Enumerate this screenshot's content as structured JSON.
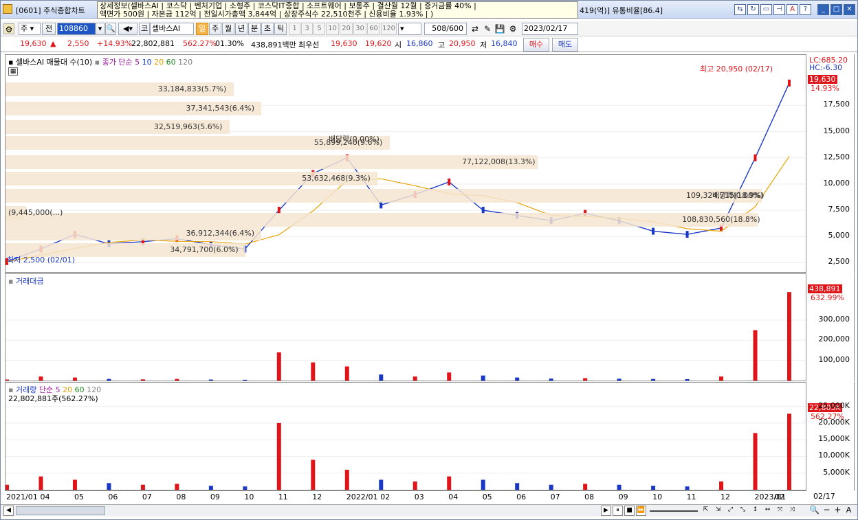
{
  "window": {
    "title": "[0601] 주식종합차트",
    "info_line1": "상세정보(셀바스AI | 코스닥 | 벤처기업 | 소형주 | 코스닥IT종합 | 소프트웨어 | 보통주 | 결산월 12월 | 증거금률 40% |",
    "info_line2": "액면가 500원 | 자본금 112억 | 전일시가총액 3,844억 | 상장주식수 22,510천주 | 신용비율 1.93% | )",
    "right_text": "419(억)] 유통비율[86.4]"
  },
  "toolbar": {
    "type_select": "주",
    "prev_label": "전",
    "code": "108860",
    "market_label": "코",
    "stock_name": "셀바스AI",
    "periods": [
      "일",
      "주",
      "월",
      "년",
      "분",
      "초",
      "틱"
    ],
    "active_period": "일",
    "intervals": [
      "1",
      "3",
      "5",
      "10",
      "20",
      "30",
      "60",
      "120"
    ],
    "count": "508",
    "count_total": "/600",
    "date": "2023/02/17"
  },
  "quote": {
    "price": "19,630",
    "arrow": "▲",
    "change": "2,550",
    "change_pct": "+14.93%",
    "volume": "22,802,881",
    "volume_ratio": "562.27%",
    "turnover": "01.30%",
    "amount": "438,891백만",
    "best_label": "최우선",
    "best_ask": "19,630",
    "best_bid": "19,620",
    "open_label": "시",
    "open": "16,860",
    "high_label": "고",
    "high": "20,950",
    "low_label": "저",
    "low": "16,840",
    "buy_label": "매수",
    "sell_label": "매도"
  },
  "price_pane": {
    "title": "셀바스AI 매물대 수(10)",
    "ma_label": "종가 단순",
    "ma_periods": [
      "5",
      "10",
      "20",
      "60",
      "120"
    ],
    "ma_colors": [
      "#1a38c8",
      "#1a38c8",
      "#e8a000",
      "#1f8a1f",
      "#808080"
    ],
    "lc_label": "LC:685.20",
    "hc_label": "HC:-6.30",
    "current_price": "19,630",
    "current_pct": "14.93%",
    "high_annot": "최고 20,950 (02/17)",
    "low_annot": "최저 2,500 (02/01)",
    "dividend_annots": [
      "배당락(0.00%)",
      "배당락(0.00%)"
    ],
    "y_ticks": [
      "17,500",
      "15,000",
      "12,500",
      "10,000",
      "7,500",
      "5,000",
      "2,500"
    ],
    "volume_profile": [
      {
        "label": "33,184,833(5.7%)",
        "frac": 0.057
      },
      {
        "label": "37,341,543(6.4%)",
        "frac": 0.064
      },
      {
        "label": "32,519,963(5.6%)",
        "frac": 0.056
      },
      {
        "label": "55,899,240(9.6%)",
        "frac": 0.096
      },
      {
        "label": "77,122,008(13.3%)",
        "frac": 0.133
      },
      {
        "label": "53,632,468(9.3%)",
        "frac": 0.093
      },
      {
        "label": "109,324,715(18.9%)",
        "frac": 0.189
      },
      {
        "label": "(9,445,000(...)",
        "frac": 0.0
      },
      {
        "label": "108,830,560(18.8%)",
        "frac": 0.188
      },
      {
        "label": "36,912,344(6.4%)",
        "frac": 0.064
      },
      {
        "label": "34,791,700(6.0%)",
        "frac": 0.06
      }
    ]
  },
  "amount_pane": {
    "title": "거래대금",
    "current": "438,891",
    "current_pct": "632.99%",
    "y_ticks": [
      "300,000",
      "200,000",
      "100,000"
    ]
  },
  "volume_pane": {
    "title": "거래량",
    "ma_label": "단순",
    "ma_periods": [
      "5",
      "20",
      "60",
      "120"
    ],
    "current_line": "22,802,881주(562.27%)",
    "current": "22,803K",
    "current_pct": "562.27%",
    "y_ticks": [
      "25,000K",
      "20,000K",
      "15,000K",
      "10,000K",
      "5,000K"
    ]
  },
  "x_axis": {
    "ticks": [
      "2021/01",
      "04",
      "05",
      "06",
      "07",
      "08",
      "09",
      "10",
      "11",
      "12",
      "2022/01",
      "02",
      "03",
      "04",
      "05",
      "06",
      "07",
      "08",
      "09",
      "10",
      "11",
      "12",
      "2023/01",
      "02"
    ],
    "right_label": "02/17"
  },
  "chart_data": {
    "type": "line",
    "title": "셀바스AI 매물대 수(10)",
    "x": [
      "2021/01",
      "2021/04",
      "2021/05",
      "2021/06",
      "2021/07",
      "2021/08",
      "2021/09",
      "2021/10",
      "2021/11",
      "2021/12",
      "2022/01",
      "2022/02",
      "2022/03",
      "2022/04",
      "2022/05",
      "2022/06",
      "2022/07",
      "2022/08",
      "2022/09",
      "2022/10",
      "2022/11",
      "2022/12",
      "2023/01",
      "2023/02"
    ],
    "series": [
      {
        "name": "종가",
        "values": [
          2600,
          3800,
          5200,
          4300,
          4500,
          4800,
          4200,
          3800,
          7500,
          11000,
          12500,
          8000,
          9000,
          10200,
          7500,
          7000,
          6500,
          7200,
          6500,
          5500,
          5200,
          5800,
          12500,
          19630
        ]
      }
    ],
    "ylim": [
      2000,
      21000
    ],
    "y_ticks": [
      2500,
      5000,
      7500,
      10000,
      12500,
      15000,
      17500
    ],
    "amount_values": [
      5000,
      20000,
      15000,
      8000,
      6000,
      8000,
      5000,
      4000,
      140000,
      90000,
      70000,
      30000,
      20000,
      40000,
      25000,
      15000,
      10000,
      12000,
      9000,
      8000,
      7000,
      20000,
      250000,
      438891
    ],
    "amount_ylim": [
      0,
      460000
    ],
    "volume_values": [
      1500,
      4000,
      3000,
      2000,
      1500,
      1800,
      1200,
      1000,
      20000,
      9000,
      6000,
      3000,
      2500,
      4000,
      3000,
      2000,
      1500,
      1800,
      1500,
      1200,
      1000,
      2500,
      17000,
      22803
    ],
    "volume_ylim": [
      0,
      28000
    ]
  }
}
